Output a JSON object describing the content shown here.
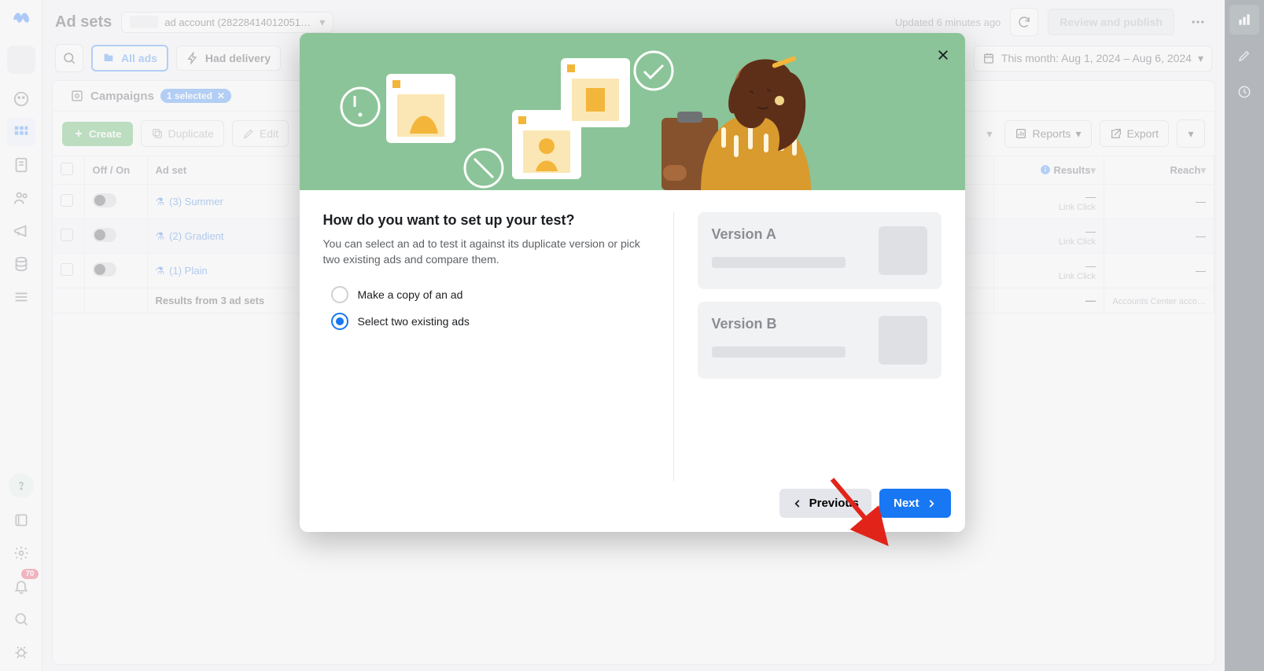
{
  "header": {
    "title": "Ad sets",
    "account_label": "ad account (28228414012051…",
    "updated_text": "Updated 6 minutes ago",
    "review_publish": "Review and publish"
  },
  "filters": {
    "all_ads": "All ads",
    "had_delivery": "Had delivery",
    "date_range": "This month: Aug 1, 2024 – Aug 6, 2024"
  },
  "tabs": {
    "campaigns": "Campaigns",
    "selected_pill": "1 selected"
  },
  "toolbar": {
    "create": "Create",
    "duplicate": "Duplicate",
    "edit": "Edit",
    "reports": "Reports",
    "export": "Export"
  },
  "table": {
    "columns": {
      "off_on": "Off / On",
      "ad_set": "Ad set",
      "results": "Results",
      "reach": "Reach"
    },
    "rows": [
      {
        "name": "(3) Summer",
        "results_metric": "Link Click",
        "results_value": "—",
        "reach": "—"
      },
      {
        "name": "(2) Gradient",
        "results_metric": "Link Click",
        "results_value": "—",
        "reach": "—"
      },
      {
        "name": "(1) Plain",
        "results_metric": "Link Click",
        "results_value": "—",
        "reach": "—"
      }
    ],
    "footer": {
      "label": "Results from 3 ad sets",
      "results_value": "—",
      "reach_note": "Accounts Center acco…"
    }
  },
  "left_rail": {
    "notification_count": "70"
  },
  "modal": {
    "heading": "How do you want to set up your test?",
    "subtext": "You can select an ad to test it against its duplicate version or pick two existing ads and compare them.",
    "option_copy": "Make a copy of an ad",
    "option_select_two": "Select two existing ads",
    "version_a": "Version A",
    "version_b": "Version B",
    "previous": "Previous",
    "next": "Next"
  }
}
